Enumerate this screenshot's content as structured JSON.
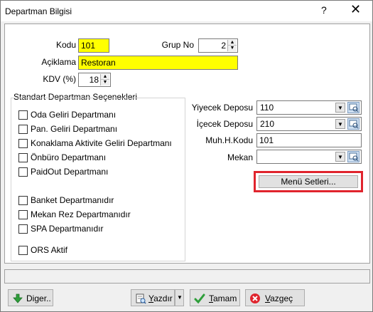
{
  "window": {
    "title": "Departman Bilgisi",
    "help_label": "?",
    "close_label": "✕"
  },
  "form": {
    "kodu_label": "Kodu",
    "kodu_value": "101",
    "grupno_label": "Grup No",
    "grupno_value": "2",
    "aciklama_label": "Açiklama",
    "aciklama_value": "Restoran",
    "kdv_label": "KDV (%)",
    "kdv_value": "18"
  },
  "options": {
    "title": "Standart Departman Seçenekleri",
    "items": [
      {
        "label": "Oda Geliri Departmanı",
        "checked": false
      },
      {
        "label": "Pan. Geliri Departmanı",
        "checked": false
      },
      {
        "label": "Konaklama Aktivite Geliri Departmanı",
        "checked": false
      },
      {
        "label": "Önbüro Departmanı",
        "checked": false
      },
      {
        "label": "PaidOut Departmanı",
        "checked": false
      },
      {
        "label": "Banket Departmanıdır",
        "checked": false
      },
      {
        "label": "Mekan Rez Departmanıdır",
        "checked": false
      },
      {
        "label": "SPA Departmanıdır",
        "checked": false
      },
      {
        "label": "ORS Aktif",
        "checked": false
      }
    ]
  },
  "right": {
    "yiyecek_label": "Yiyecek Deposu",
    "yiyecek_value": "110",
    "icecek_label": "İçecek Deposu",
    "icecek_value": "210",
    "muh_label": "Muh.H.Kodu",
    "muh_value": "101",
    "mekan_label": "Mekan",
    "mekan_value": "",
    "menu_button": "Menü Setleri..."
  },
  "footer": {
    "diger_prefix": "Di",
    "diger_underline": "g",
    "diger_suffix": "er..",
    "yazdir_underline": "Y",
    "yazdir_suffix": "azdır",
    "tamam_underline": "T",
    "tamam_suffix": "amam",
    "vazgec_underline": "V",
    "vazgec_suffix": "azgeç"
  },
  "colors": {
    "highlight_field": "#ffff00",
    "menu_outline": "#e0242d"
  }
}
